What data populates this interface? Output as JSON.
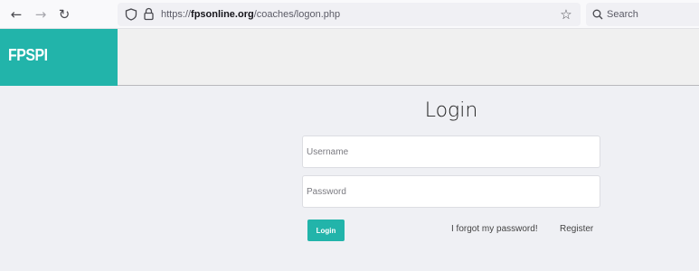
{
  "browser": {
    "back_icon": "←",
    "forward_icon": "→",
    "reload_icon": "↻",
    "url_prefix": "https://",
    "url_domain": "fpsonline.org",
    "url_path": "/coaches/logon.php",
    "bookmark_icon": "☆",
    "search_placeholder": "Search",
    "colors": {
      "toolbar": "#f9f9fb",
      "field": "#f0f0f4"
    }
  },
  "header": {
    "logo_text": "FPSPI",
    "colors": {
      "brand": "#22b4aa",
      "bar": "#f0f0f0"
    }
  },
  "login": {
    "title": "Login",
    "username_placeholder": "Username",
    "username_value": "",
    "password_placeholder": "Password",
    "password_value": "",
    "submit_label": "Login",
    "forgot_label": "I forgot my password!",
    "register_label": "Register"
  }
}
